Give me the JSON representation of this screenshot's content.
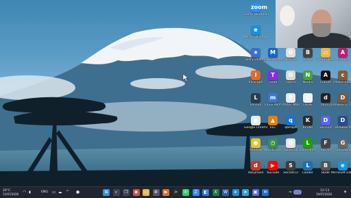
{
  "desktop": {
    "icons": [
      {
        "label": "Zoom Workplace",
        "icon": "zoom-icon",
        "color": "#2d8cff",
        "glyph": "zoom"
      },
      {
        "label": "Microsoft Edge",
        "icon": "edge-icon",
        "color": "#1c90d6",
        "glyph": "e"
      },
      {
        "label": "Glary Utilities",
        "icon": "star-icon",
        "color": "#3a6fd0",
        "glyph": "★"
      },
      {
        "label": "Malwarebytes",
        "icon": "malwarebytes-icon",
        "color": "#1b5fcf",
        "glyph": "M"
      },
      {
        "label": "OOSU10",
        "icon": "oosu-icon",
        "color": "#e0e0e0",
        "glyph": "O"
      },
      {
        "label": "Brave",
        "icon": "brave-icon",
        "color": "#444",
        "glyph": "B"
      },
      {
        "label": "Tor Browser",
        "icon": "folder-icon",
        "color": "#e8b84a",
        "glyph": "▭"
      },
      {
        "label": "Audacity",
        "icon": "audacity-icon",
        "color": "#c81b68",
        "glyph": "A"
      },
      {
        "label": "Inkscape",
        "icon": "inkscape-icon",
        "color": "#e26a22",
        "glyph": "I"
      },
      {
        "label": "Tixati",
        "icon": "tixati-icon",
        "color": "#8a2be2",
        "glyph": "T"
      },
      {
        "label": "Opera",
        "icon": "opera-icon",
        "color": "#d9d9d9",
        "glyph": "O"
      },
      {
        "label": "Nvidia",
        "icon": "nvidia-icon",
        "color": "#47a23a",
        "glyph": "N"
      },
      {
        "label": "Claude",
        "icon": "claude-icon",
        "color": "#111",
        "glyph": "A"
      },
      {
        "label": "calibre 64bit",
        "icon": "calibre-icon",
        "color": "#8b5a2b",
        "glyph": "c"
      },
      {
        "label": "Lenovo",
        "icon": "lenovo-icon",
        "color": "#2a3d4f",
        "glyph": "L"
      },
      {
        "label": "Linux Mint",
        "icon": "mint-icon",
        "color": "#3b79c8",
        "glyph": "m"
      },
      {
        "label": "Proton Mail",
        "icon": "proton-icon",
        "color": "#e8e8e8",
        "glyph": "P"
      },
      {
        "label": "CKHIE",
        "icon": "ckhie-icon",
        "color": "#f0f0f0",
        "glyph": "C"
      },
      {
        "label": "danny",
        "icon": "danny-icon",
        "color": "#222",
        "glyph": "d"
      },
      {
        "label": "DOSBox 0.74-3",
        "icon": "dosbox-icon",
        "color": "#7b5a3c",
        "glyph": "D"
      },
      {
        "label": "Google Chrome",
        "icon": "chrome-icon",
        "color": "#e9e9e9",
        "glyph": "◉"
      },
      {
        "label": "VLC",
        "icon": "vlc-icon",
        "color": "#ef7b00",
        "glyph": "▲"
      },
      {
        "label": "qbit4pe",
        "icon": "qbit-icon",
        "color": "#1a73c9",
        "glyph": "q"
      },
      {
        "label": "Kindle",
        "icon": "kindle-icon",
        "color": "#2b2b2b",
        "glyph": "K"
      },
      {
        "label": "Discord",
        "icon": "discord-icon",
        "color": "#5865f2",
        "glyph": "D"
      },
      {
        "label": "DOSBox-X",
        "icon": "dosboxx-icon",
        "color": "#2b4c8a",
        "glyph": "D"
      },
      {
        "label": "shadow",
        "icon": "shadow-icon",
        "color": "#f2c21a",
        "glyph": "●"
      },
      {
        "label": "WorldClock",
        "icon": "worldclock-icon",
        "color": "#3a8e4e",
        "glyph": "◷"
      },
      {
        "label": "QBRecall",
        "icon": "recall-icon",
        "color": "#e8e8e8",
        "glyph": "Q"
      },
      {
        "label": "LibreOffice",
        "icon": "libreoffice-icon",
        "color": "#18a303",
        "glyph": "L"
      },
      {
        "label": "FbEdit",
        "icon": "fbedit-icon",
        "color": "#444",
        "glyph": "F"
      },
      {
        "label": "GeoGebra",
        "icon": "geogebra-icon",
        "color": "#666",
        "glyph": "G"
      },
      {
        "label": "danyhos4",
        "icon": "danyhos-icon",
        "color": "#c0392b",
        "glyph": "d"
      },
      {
        "label": "YouTube",
        "icon": "youtube-icon",
        "color": "#ff0000",
        "glyph": "▶"
      },
      {
        "label": "SecretCO",
        "icon": "secret-icon",
        "color": "#3d3d3d",
        "glyph": "S"
      },
      {
        "label": "Loader",
        "icon": "loader-icon",
        "color": "#1f6fb2",
        "glyph": "L"
      },
      {
        "label": "Bode",
        "icon": "bode-icon",
        "color": "#555",
        "glyph": "B"
      },
      {
        "label": "Microsoft Edge",
        "icon": "edge-icon",
        "color": "#1c90d6",
        "glyph": "e"
      }
    ]
  },
  "taskbar": {
    "weather_temp": "20°C",
    "date_left": "15/07/2026",
    "lang": "ENG",
    "clock_time": "12:13",
    "clock_date": "19/07/2026",
    "apps": [
      {
        "icon": "start-icon",
        "color": "#3b8ed8",
        "glyph": "⊞"
      },
      {
        "icon": "search-icon",
        "color": "#3a4456",
        "glyph": "⌕"
      },
      {
        "icon": "task-view-icon",
        "color": "#3a4456",
        "glyph": "❐"
      },
      {
        "icon": "chrome-icon",
        "color": "#d84b3c",
        "glyph": "◉"
      },
      {
        "icon": "file-explorer-icon",
        "color": "#e8b84a",
        "glyph": "▭"
      },
      {
        "icon": "settings-icon",
        "color": "#556",
        "glyph": "⚙"
      },
      {
        "icon": "media-icon",
        "color": "#d9732b",
        "glyph": "▶"
      },
      {
        "icon": "terminal-icon",
        "color": "#2b2b2b",
        "glyph": ">"
      },
      {
        "icon": "whatsapp-icon",
        "color": "#25d366",
        "glyph": "✆"
      },
      {
        "icon": "zoom-icon",
        "color": "#2d8cff",
        "glyph": "Z"
      },
      {
        "icon": "vscode-icon",
        "color": "#1f7ad6",
        "glyph": "◧"
      },
      {
        "icon": "excel-icon",
        "color": "#1d7a45",
        "glyph": "X"
      },
      {
        "icon": "word-icon",
        "color": "#2b5ab5",
        "glyph": "W"
      },
      {
        "icon": "edge-icon",
        "color": "#1c90d6",
        "glyph": "e"
      },
      {
        "icon": "telegram-icon",
        "color": "#2aa3e0",
        "glyph": "➤"
      },
      {
        "icon": "photos-icon",
        "color": "#5a6fd6",
        "glyph": "▣"
      },
      {
        "icon": "mail-icon",
        "color": "#1e6fcf",
        "glyph": "✉"
      }
    ]
  }
}
